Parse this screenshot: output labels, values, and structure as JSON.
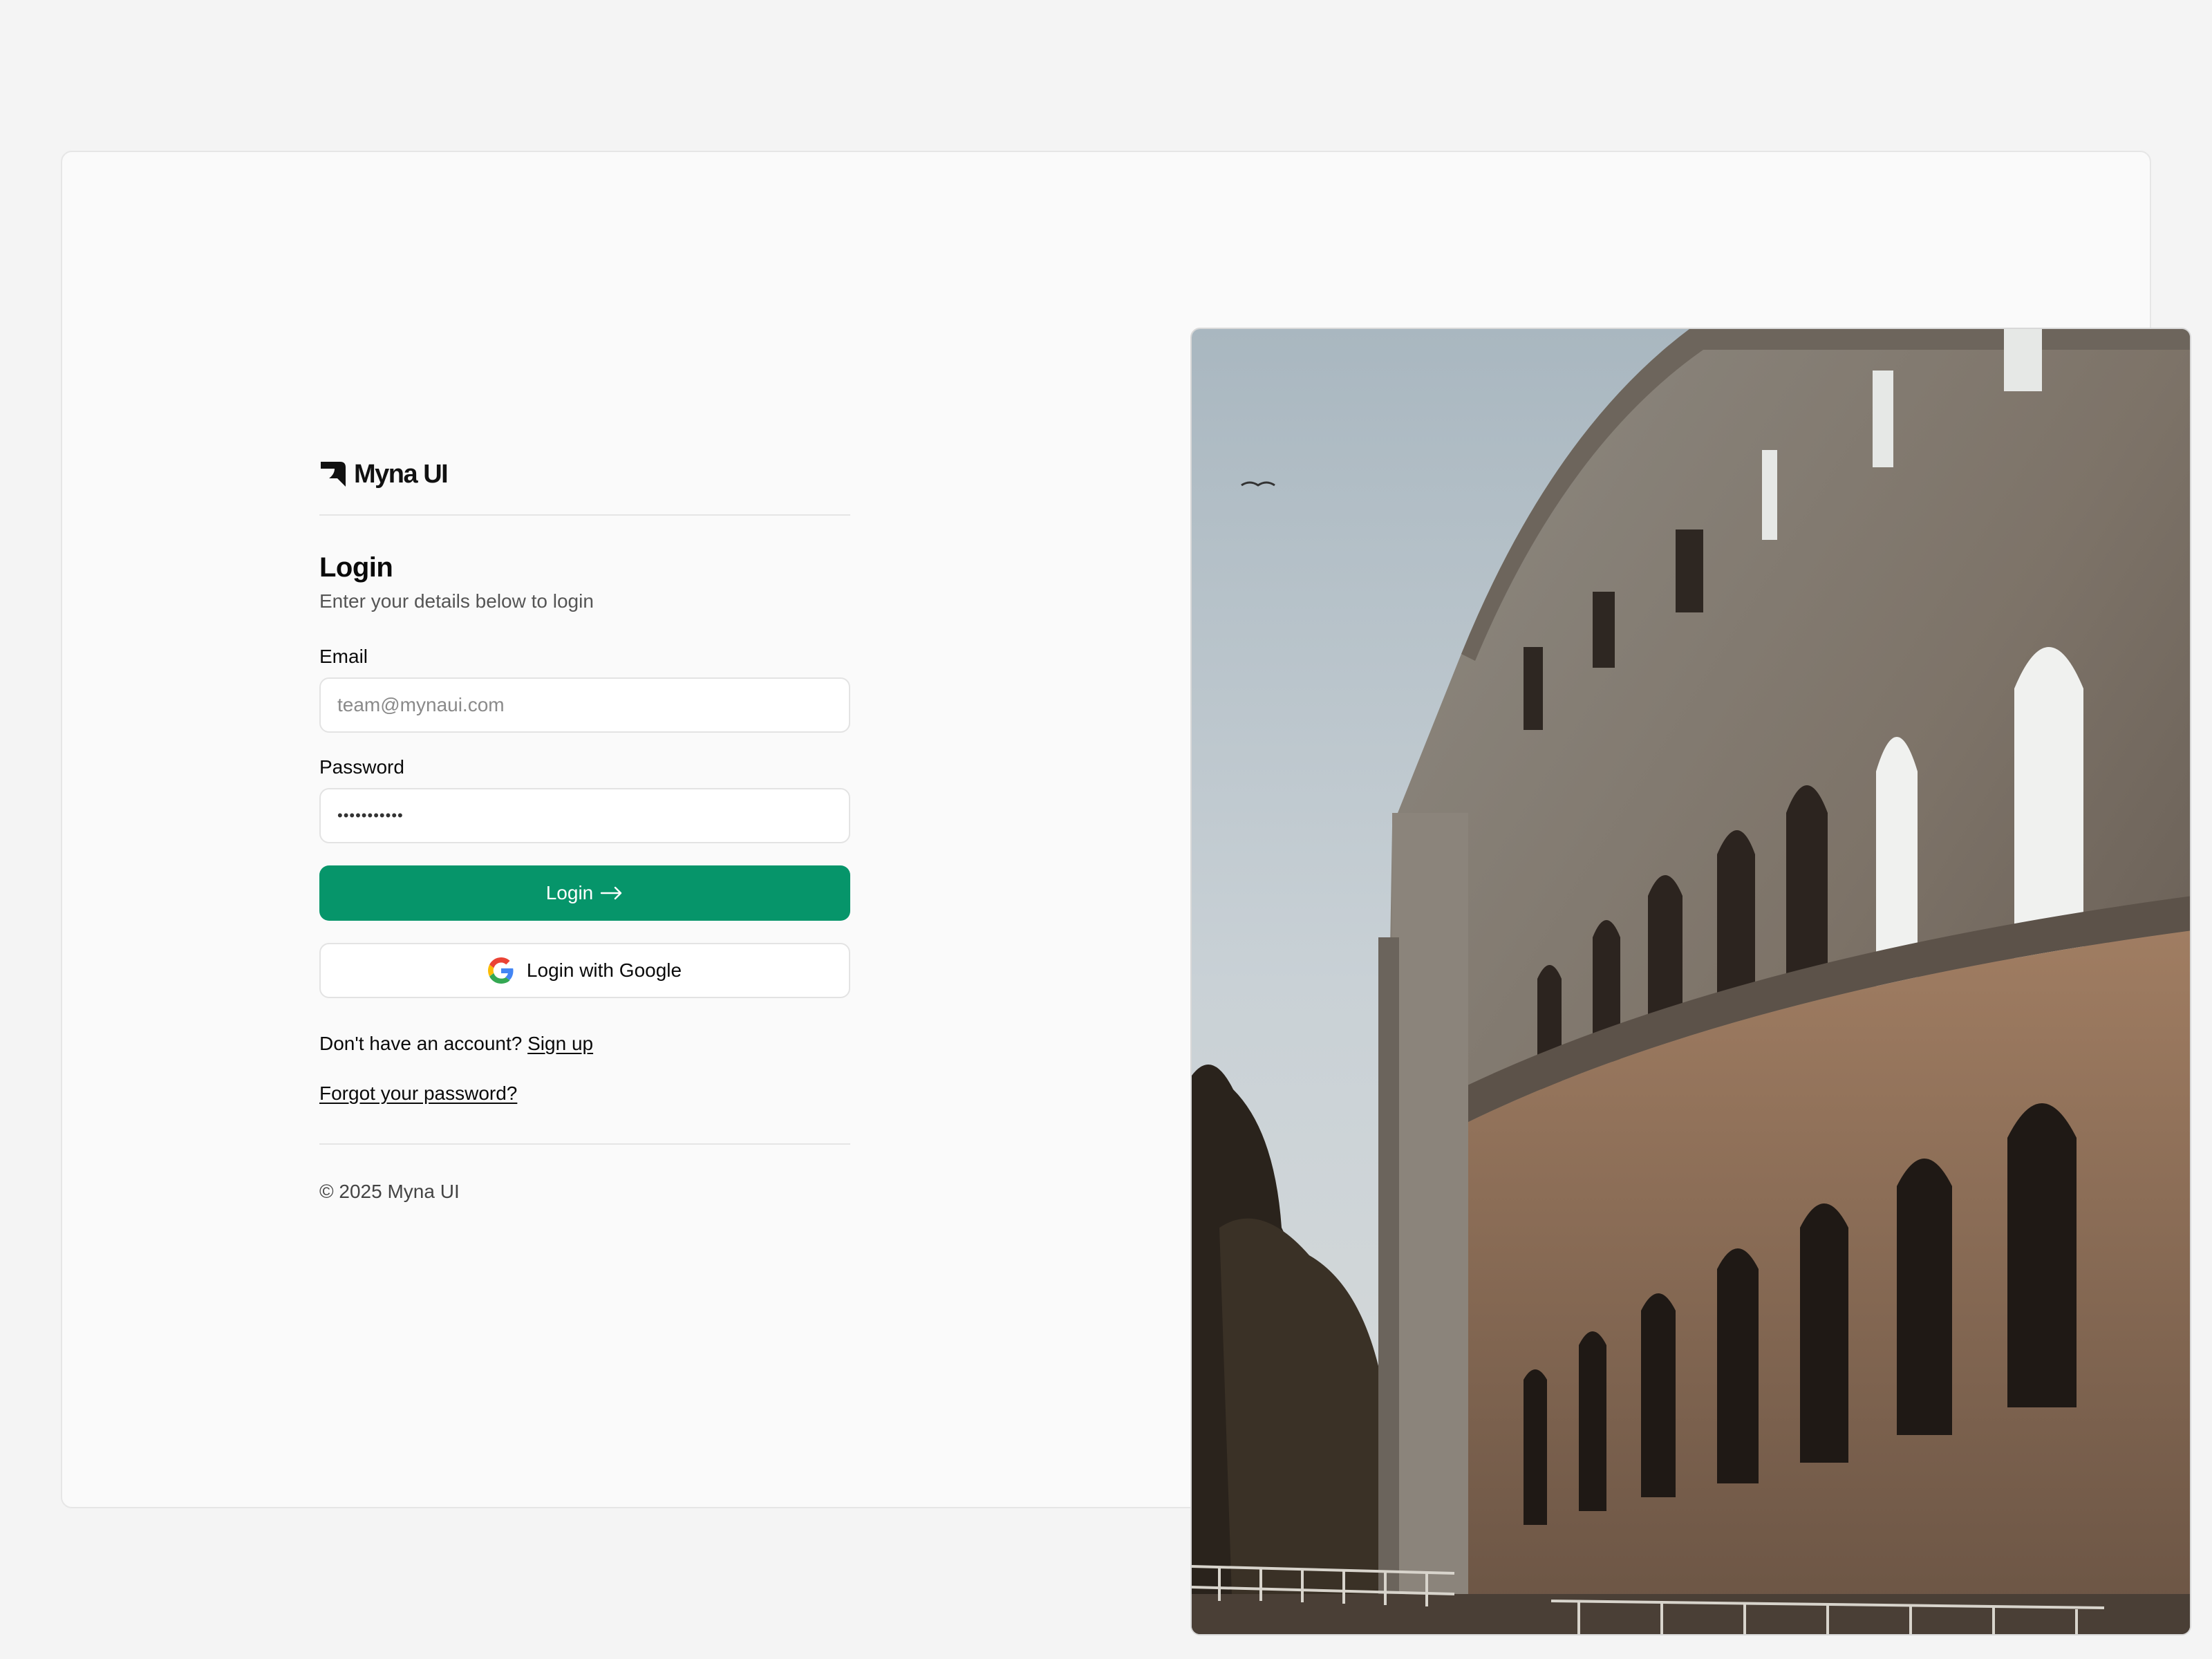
{
  "brand": {
    "name": "Myna UI",
    "logo_icon": "myna-logo-icon"
  },
  "login": {
    "title": "Login",
    "subtitle": "Enter your details below to login",
    "email": {
      "label": "Email",
      "placeholder": "team@mynaui.com",
      "value": ""
    },
    "password": {
      "label": "Password",
      "value": "•••••••••••"
    },
    "submit_label": "Login",
    "submit_icon": "arrow-right-icon",
    "google_label": "Login with Google",
    "google_icon": "google-icon",
    "signup_prompt": "Don't have an account?",
    "signup_link": "Sign up",
    "forgot_link": "Forgot your password?"
  },
  "footer": {
    "copyright": "© 2025 Myna UI"
  },
  "colors": {
    "accent": "#06956a",
    "card_bg": "#fafafa",
    "page_bg": "#f4f4f4"
  },
  "image": {
    "subject": "colosseum-photo"
  }
}
